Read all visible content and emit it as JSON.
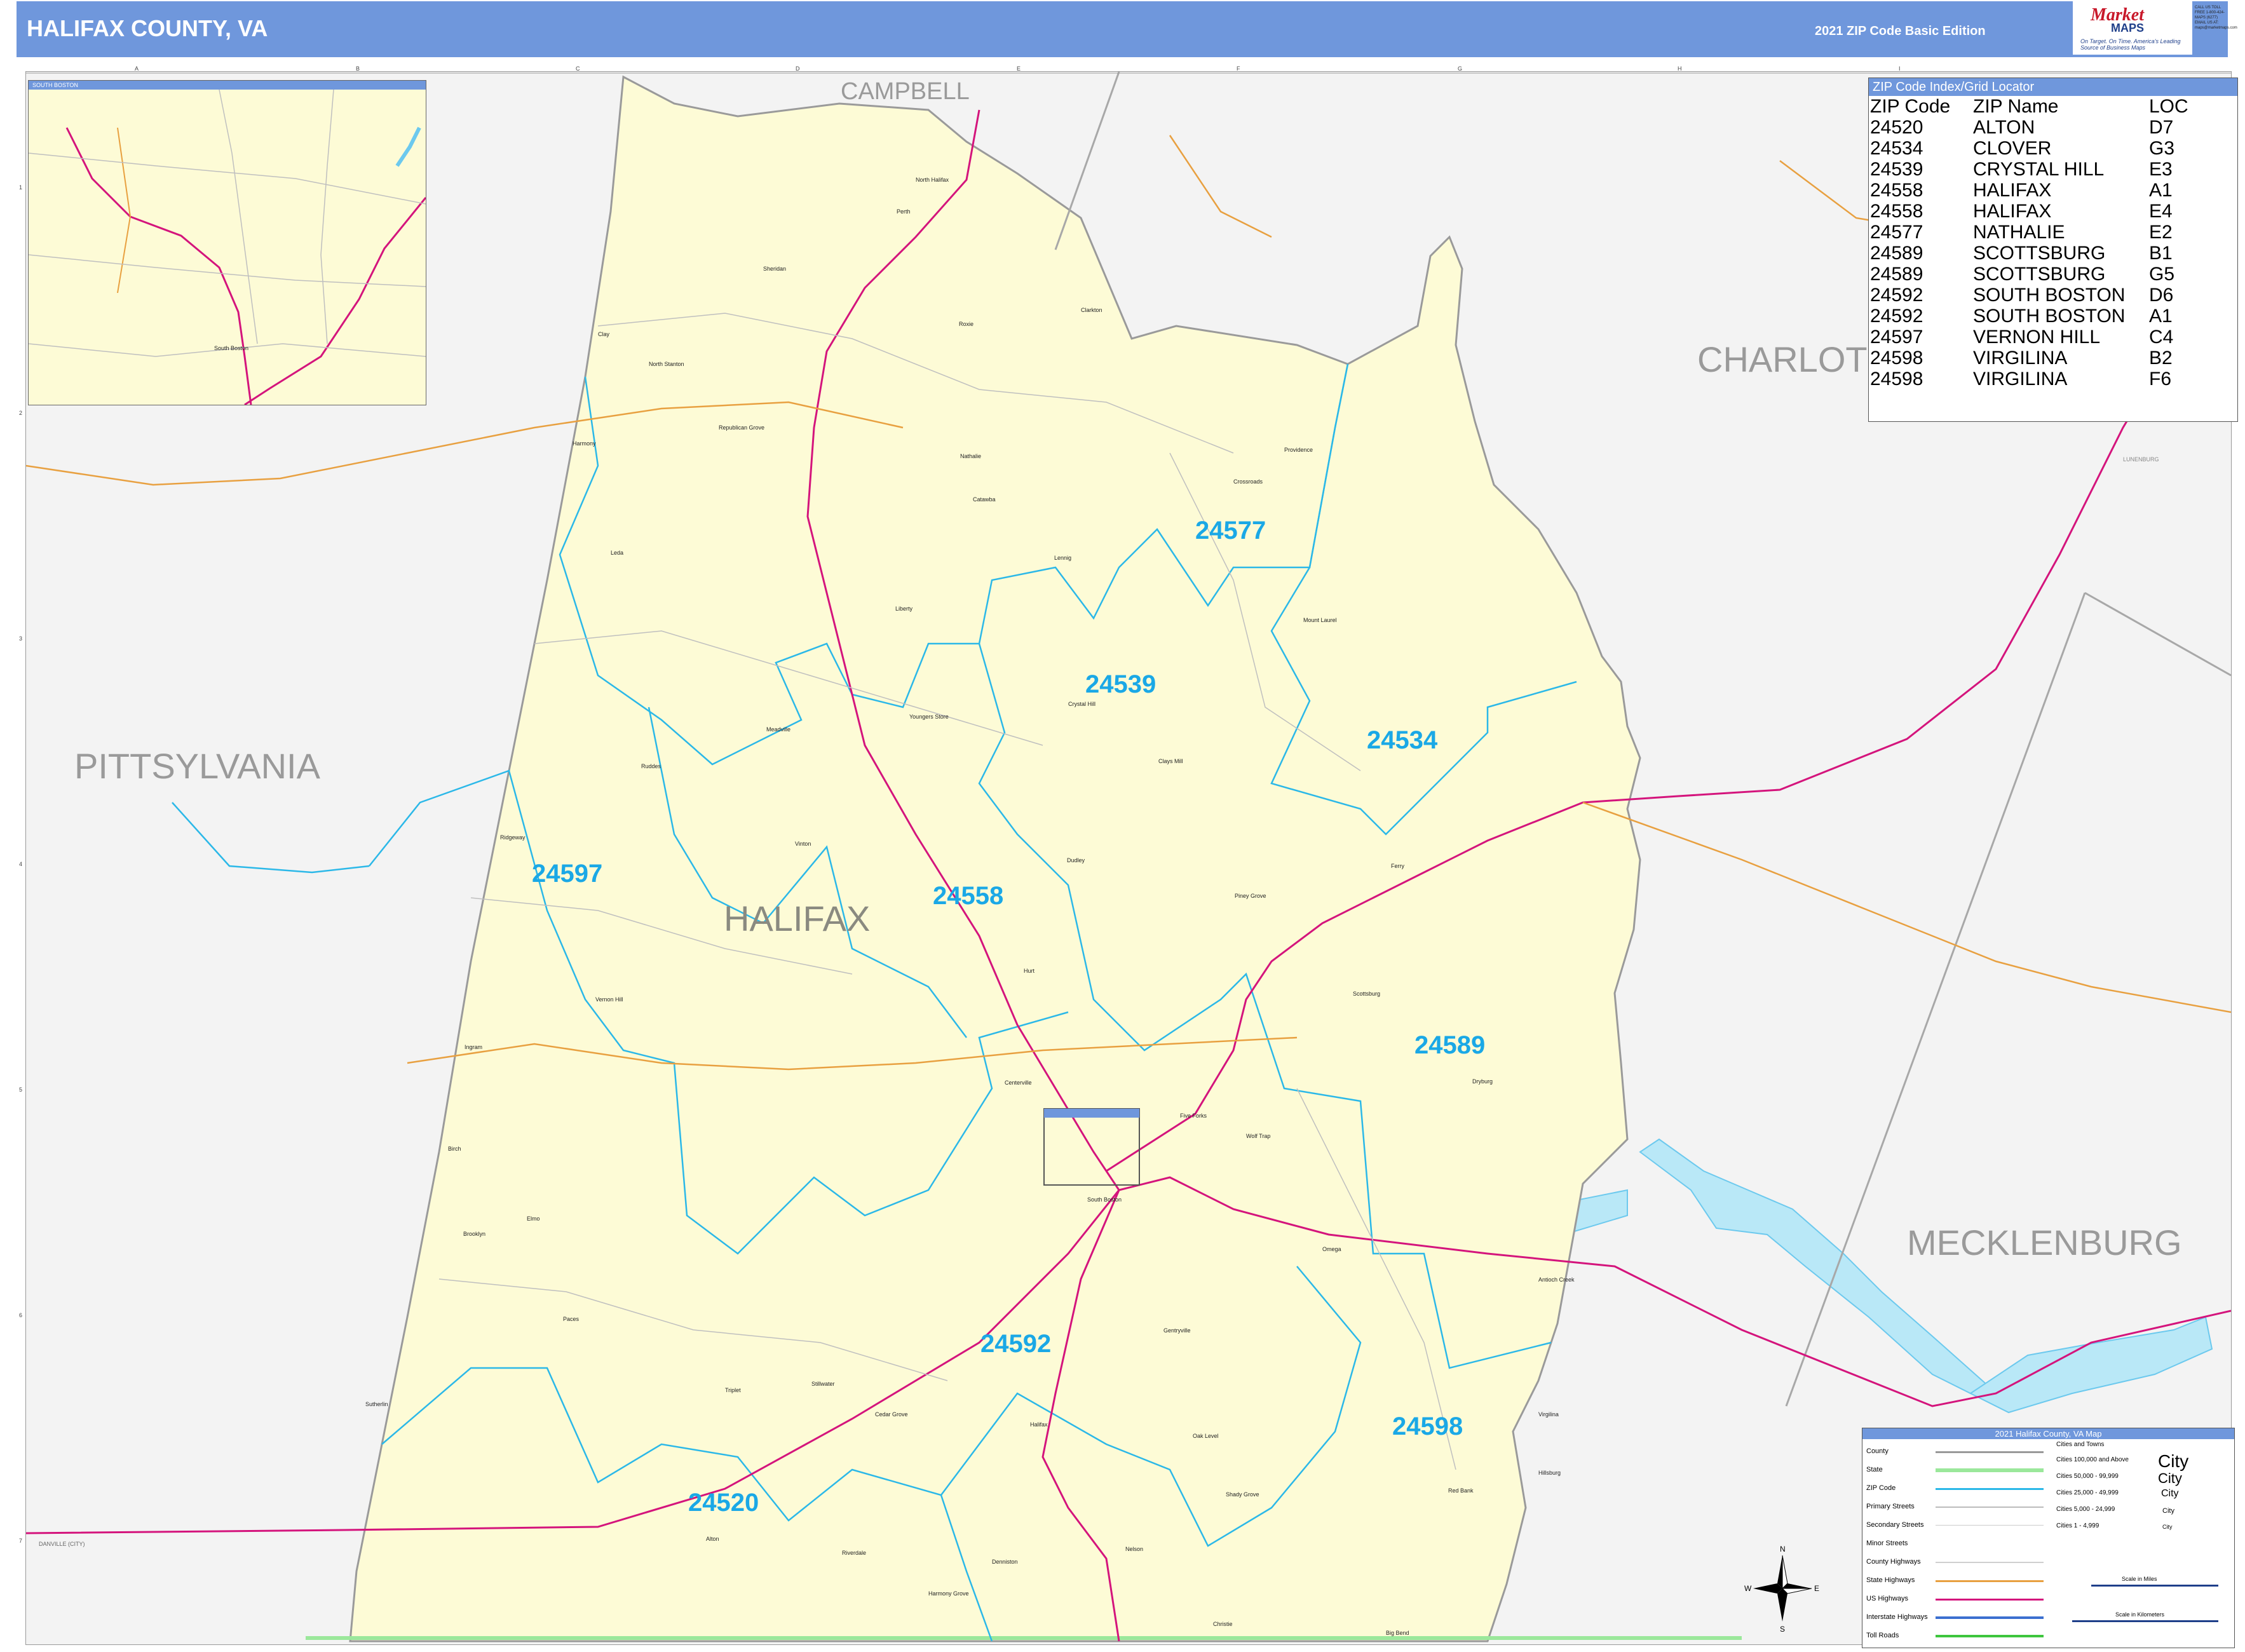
{
  "header": {
    "title": "HALIFAX COUNTY, VA",
    "edition": "2021 ZIP Code Basic Edition",
    "logo_line1": "Market",
    "logo_line2": "MAPS",
    "logo_tagline": "On Target. On Time. America's Leading Source of Business Maps",
    "contact": "CALL US TOLL FREE 1-800-424-MAPS (6277) EMAIL US AT: maps@marketmaps.com"
  },
  "map": {
    "county": "HALIFAX",
    "neighbors": [
      "CAMPBELL",
      "CHARLOT",
      "PITTSYLVANIA",
      "MECKLENBURG"
    ],
    "small_labels": [
      "LUNENBURG",
      "DANVILLE (CITY)"
    ],
    "grid_cols": [
      "A",
      "B",
      "C",
      "D",
      "E",
      "F",
      "G",
      "H",
      "I"
    ],
    "grid_rows": [
      "1",
      "2",
      "3",
      "4",
      "5",
      "6",
      "7"
    ],
    "zip_labels": [
      "24577",
      "24539",
      "24534",
      "24558",
      "24597",
      "24589",
      "24592",
      "24598",
      "24520"
    ],
    "places": [
      "North Halifax",
      "Perth",
      "Sheridan",
      "Clarkton",
      "Roxie",
      "Clay",
      "North Stanton",
      "Republican Grove",
      "Harmony",
      "Nathalie",
      "Providence",
      "Crossroads",
      "Catawba",
      "Lennig",
      "Liberty",
      "Leda",
      "Meadville",
      "Mount Laurel",
      "Crystal Hill",
      "Youngers Store",
      "Clays Mill",
      "Ruddes",
      "Ridgeway",
      "Vinton",
      "Dudley",
      "Piney Grove",
      "Ferry",
      "Hurt",
      "Vernon Hill",
      "Scottsburg",
      "Ingram",
      "Centerville",
      "Birch",
      "Five Forks",
      "Wolf Trap",
      "Elmo",
      "Brooklyn",
      "Omega",
      "Antioch Creek",
      "Paces",
      "Gentryville",
      "Triplet",
      "Stillwater",
      "Sutherlin",
      "Cedar Grove",
      "Halifax",
      "Oak Level",
      "Virgilina",
      "Alton",
      "Riverdale",
      "Nelson",
      "Shady Grove",
      "Red Bank",
      "Hillsburg",
      "Denniston",
      "Harmony Grove",
      "Christie",
      "Big Bend",
      "South Boston",
      "Dryburg"
    ]
  },
  "inset": {
    "title": "SOUTH BOSTON",
    "town": "South Boston"
  },
  "zip_index": {
    "title": "ZIP Code Index/Grid Locator",
    "headers": [
      "ZIP Code",
      "ZIP Name",
      "LOC"
    ],
    "rows": [
      [
        "24520",
        "ALTON",
        "D7"
      ],
      [
        "24534",
        "CLOVER",
        "G3"
      ],
      [
        "24539",
        "CRYSTAL HILL",
        "E3"
      ],
      [
        "24558",
        "HALIFAX",
        "A1"
      ],
      [
        "24558",
        "HALIFAX",
        "E4"
      ],
      [
        "24577",
        "NATHALIE",
        "E2"
      ],
      [
        "24589",
        "SCOTTSBURG",
        "B1"
      ],
      [
        "24589",
        "SCOTTSBURG",
        "G5"
      ],
      [
        "24592",
        "SOUTH BOSTON",
        "D6"
      ],
      [
        "24592",
        "SOUTH BOSTON",
        "A1"
      ],
      [
        "24597",
        "VERNON HILL",
        "C4"
      ],
      [
        "24598",
        "VIRGILINA",
        "B2"
      ],
      [
        "24598",
        "VIRGILINA",
        "F6"
      ]
    ]
  },
  "legend": {
    "title": "2021 Halifax County, VA Map",
    "items": [
      "County",
      "State",
      "ZIP Code",
      "Primary Streets",
      "Secondary Streets",
      "Minor Streets",
      "County Highways",
      "State Highways",
      "US Highways",
      "Interstate Highways",
      "Toll Roads"
    ],
    "cities_header": "Cities and Towns",
    "city_classes": [
      "Cities 100,000 and Above",
      "Cities 50,000 - 99,999",
      "Cities 25,000 - 49,999",
      "Cities 5,000 - 24,999",
      "Cities 1 - 4,999"
    ],
    "city_samples": [
      "City",
      "City",
      "City",
      "City",
      "City"
    ],
    "scale_miles": "Scale in Miles",
    "scale_km": "Scale in Kilometers",
    "compass": [
      "N",
      "S",
      "E",
      "W"
    ],
    "colors": {
      "county": "#999999",
      "state": "#9be89b",
      "zip": "#2bb8e8",
      "us_highway": "#d4147c",
      "state_highway": "#e8a040",
      "water": "#b9e8f7",
      "county_fill": "#fdfbd6"
    }
  }
}
